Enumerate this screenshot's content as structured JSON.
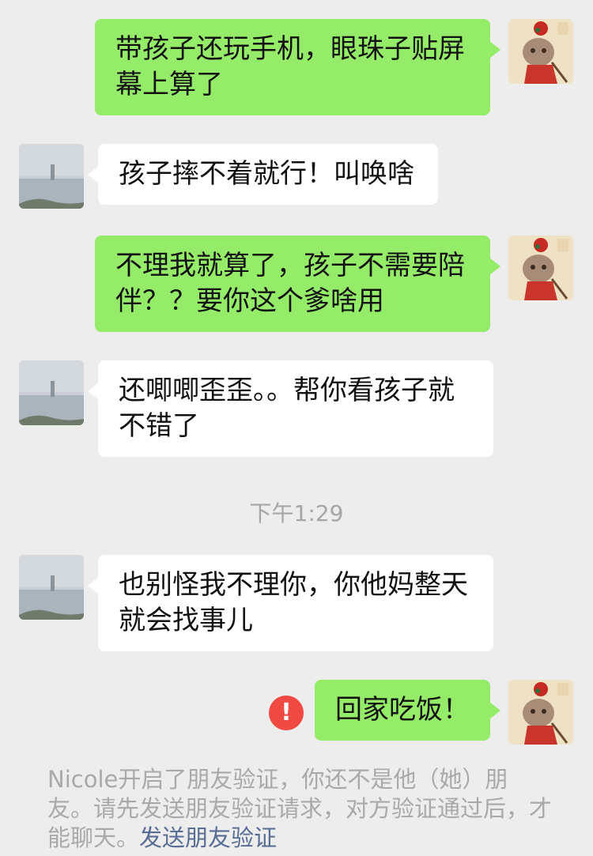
{
  "messages": [
    {
      "id": "m1",
      "sender": "me",
      "lines": [
        "带孩子还玩手机，眼珠子贴屏",
        "幕上算了"
      ]
    },
    {
      "id": "m2",
      "sender": "them",
      "lines": [
        "孩子摔不着就行！叫唤啥"
      ]
    },
    {
      "id": "m3",
      "sender": "me",
      "lines": [
        "不理我就算了，孩子不需要陪",
        "伴？？要你这个爹啥用"
      ]
    },
    {
      "id": "m4",
      "sender": "them",
      "lines": [
        "还唧唧歪歪。。帮你看孩子就",
        "不错了"
      ]
    },
    {
      "id": "m5",
      "sender": "them",
      "lines": [
        "也别怪我不理你，你他妈整天",
        "就会找事儿"
      ]
    },
    {
      "id": "m6",
      "sender": "me",
      "lines": [
        "回家吃饭！"
      ]
    }
  ],
  "timestamp": "下午1:29",
  "error_mark": "!",
  "system_notice": {
    "text": "Nicole开启了朋友验证，你还不是他（她）朋友。请先发送朋友验证请求，对方验证通过后，才能聊天。",
    "link": "发送朋友验证"
  },
  "colors": {
    "background": "#ededed",
    "my_bubble": "#95ec69",
    "their_bubble": "#ffffff",
    "error_red": "#f04a43",
    "link_blue": "#586c94",
    "muted_text": "#a9a9a9"
  }
}
